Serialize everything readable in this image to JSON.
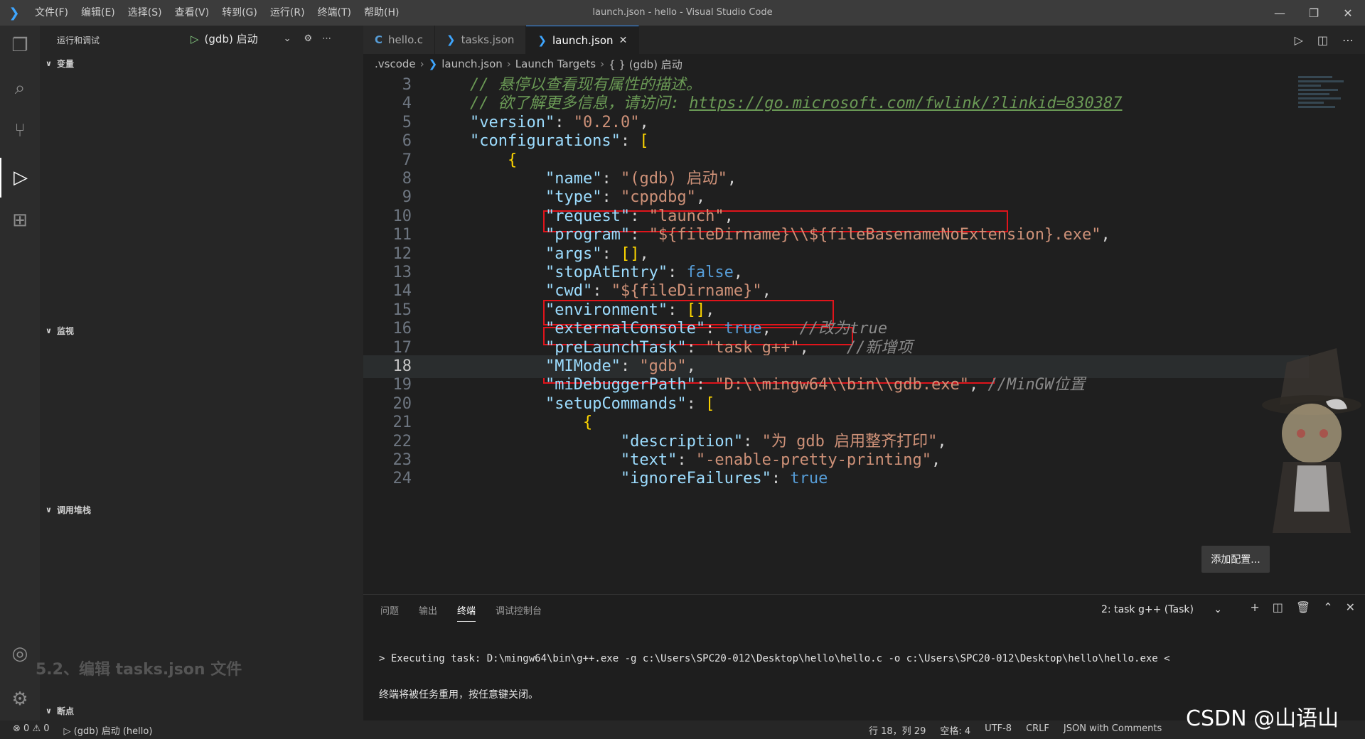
{
  "window": {
    "title": "launch.json - hello - Visual Studio Code",
    "menu": [
      "文件(F)",
      "编辑(E)",
      "选择(S)",
      "查看(V)",
      "转到(G)",
      "运行(R)",
      "终端(T)",
      "帮助(H)"
    ]
  },
  "sidebar": {
    "header": "运行和调试",
    "config_name": "(gdb) 启动",
    "sections": {
      "variables": "变量",
      "watch": "监视",
      "callstack": "调用堆栈",
      "breakpoints": "断点"
    },
    "background_heading": "5.2、编辑 tasks.json 文件"
  },
  "tabs": [
    {
      "label": "hello.c",
      "icon": "c-file-icon"
    },
    {
      "label": "tasks.json",
      "icon": "vscode-json-icon"
    },
    {
      "label": "launch.json",
      "icon": "vscode-json-icon"
    }
  ],
  "breadcrumb": [
    ".vscode",
    "launch.json",
    "Launch Targets",
    "{ } (gdb) 启动"
  ],
  "editor": {
    "current_line": 18,
    "lines": [
      {
        "n": "3",
        "t": [
          [
            "c",
            "// 悬停以查看现有属性的描述。"
          ]
        ]
      },
      {
        "n": "4",
        "t": [
          [
            "c",
            "// 欲了解更多信息，请访问: "
          ],
          [
            "c url",
            "https://go.microsoft.com/fwlink/?linkid=830387"
          ]
        ]
      },
      {
        "n": "5",
        "t": [
          [
            "k",
            "\"version\""
          ],
          [
            "p",
            ": "
          ],
          [
            "s",
            "\"0.2.0\""
          ],
          [
            "p",
            ","
          ]
        ]
      },
      {
        "n": "6",
        "t": [
          [
            "k",
            "\"configurations\""
          ],
          [
            "p",
            ": "
          ],
          [
            "b",
            "["
          ]
        ]
      },
      {
        "n": "7",
        "t": [
          [
            "p",
            "    "
          ],
          [
            "b",
            "{"
          ]
        ]
      },
      {
        "n": "8",
        "t": [
          [
            "p",
            "        "
          ],
          [
            "k",
            "\"name\""
          ],
          [
            "p",
            ": "
          ],
          [
            "s",
            "\"(gdb) 启动\""
          ],
          [
            "p",
            ","
          ]
        ]
      },
      {
        "n": "9",
        "t": [
          [
            "p",
            "        "
          ],
          [
            "k",
            "\"type\""
          ],
          [
            "p",
            ": "
          ],
          [
            "s",
            "\"cppdbg\""
          ],
          [
            "p",
            ","
          ]
        ]
      },
      {
        "n": "10",
        "t": [
          [
            "p",
            "        "
          ],
          [
            "k",
            "\"request\""
          ],
          [
            "p",
            ": "
          ],
          [
            "s",
            "\"launch\""
          ],
          [
            "p",
            ","
          ]
        ]
      },
      {
        "n": "11",
        "t": [
          [
            "p",
            "        "
          ],
          [
            "k",
            "\"program\""
          ],
          [
            "p",
            ": "
          ],
          [
            "s",
            "\"${fileDirname}\\\\${fileBasenameNoExtension}.exe\""
          ],
          [
            "p",
            ","
          ]
        ]
      },
      {
        "n": "12",
        "t": [
          [
            "p",
            "        "
          ],
          [
            "k",
            "\"args\""
          ],
          [
            "p",
            ": "
          ],
          [
            "b",
            "[]"
          ],
          [
            "p",
            ","
          ]
        ]
      },
      {
        "n": "13",
        "t": [
          [
            "p",
            "        "
          ],
          [
            "k",
            "\"stopAtEntry\""
          ],
          [
            "p",
            ": "
          ],
          [
            "lit",
            "false"
          ],
          [
            "p",
            ","
          ]
        ]
      },
      {
        "n": "14",
        "t": [
          [
            "p",
            "        "
          ],
          [
            "k",
            "\"cwd\""
          ],
          [
            "p",
            ": "
          ],
          [
            "s",
            "\"${fileDirname}\""
          ],
          [
            "p",
            ","
          ]
        ]
      },
      {
        "n": "15",
        "t": [
          [
            "p",
            "        "
          ],
          [
            "k",
            "\"environment\""
          ],
          [
            "p",
            ": "
          ],
          [
            "b",
            "[]"
          ],
          [
            "p",
            ","
          ]
        ]
      },
      {
        "n": "16",
        "t": [
          [
            "p",
            "        "
          ],
          [
            "k",
            "\"externalConsole\""
          ],
          [
            "p",
            ": "
          ],
          [
            "lit",
            "true"
          ],
          [
            "p",
            ",   "
          ],
          [
            "cg",
            "//改为true"
          ]
        ]
      },
      {
        "n": "17",
        "t": [
          [
            "p",
            "        "
          ],
          [
            "k",
            "\"preLaunchTask\""
          ],
          [
            "p",
            ": "
          ],
          [
            "s",
            "\"task g++\""
          ],
          [
            "p",
            ",    "
          ],
          [
            "cg",
            "//新增项"
          ]
        ]
      },
      {
        "n": "18",
        "t": [
          [
            "p",
            "        "
          ],
          [
            "k",
            "\"MIMode\""
          ],
          [
            "p",
            ": "
          ],
          [
            "s",
            "\"gdb\""
          ],
          [
            "p",
            ","
          ]
        ]
      },
      {
        "n": "19",
        "t": [
          [
            "p",
            "        "
          ],
          [
            "k",
            "\"miDebuggerPath\""
          ],
          [
            "p",
            ": "
          ],
          [
            "s",
            "\"D:\\\\mingw64\\\\bin\\\\gdb.exe\""
          ],
          [
            "p",
            ", "
          ],
          [
            "cg",
            "//MinGW位置"
          ]
        ]
      },
      {
        "n": "20",
        "t": [
          [
            "p",
            "        "
          ],
          [
            "k",
            "\"setupCommands\""
          ],
          [
            "p",
            ": "
          ],
          [
            "b",
            "["
          ]
        ]
      },
      {
        "n": "21",
        "t": [
          [
            "p",
            "            "
          ],
          [
            "b",
            "{"
          ]
        ]
      },
      {
        "n": "22",
        "t": [
          [
            "p",
            "                "
          ],
          [
            "k",
            "\"description\""
          ],
          [
            "p",
            ": "
          ],
          [
            "s",
            "\"为 gdb 启用整齐打印\""
          ],
          [
            "p",
            ","
          ]
        ]
      },
      {
        "n": "23",
        "t": [
          [
            "p",
            "                "
          ],
          [
            "k",
            "\"text\""
          ],
          [
            "p",
            ": "
          ],
          [
            "s",
            "\"-enable-pretty-printing\""
          ],
          [
            "p",
            ","
          ]
        ]
      },
      {
        "n": "24",
        "t": [
          [
            "p",
            "                "
          ],
          [
            "k",
            "\"ignoreFailures\""
          ],
          [
            "p",
            ": "
          ],
          [
            "lit",
            "true"
          ]
        ]
      }
    ]
  },
  "add_config_label": "添加配置...",
  "panel": {
    "tabs": [
      "问题",
      "输出",
      "终端",
      "调试控制台"
    ],
    "active_tab": "终端",
    "terminal_select": "2: task g++ (Task)",
    "terminal_lines": [
      "> Executing task: D:\\mingw64\\bin\\g++.exe -g c:\\Users\\SPC20-012\\Desktop\\hello\\hello.c -o c:\\Users\\SPC20-012\\Desktop\\hello\\hello.exe <",
      "终端将被任务重用，按任意键关闭。"
    ]
  },
  "statusbar": {
    "errors": "0",
    "warnings": "0",
    "debug_config": "(gdb) 启动 (hello)",
    "position": "行 18，列 29",
    "spaces": "空格: 4",
    "encoding": "UTF-8",
    "eol": "CRLF",
    "language": "JSON with Comments"
  },
  "watermark": "CSDN @山语山"
}
